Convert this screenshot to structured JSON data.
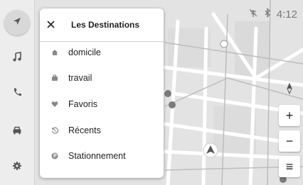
{
  "header": {
    "time": "4:12"
  },
  "sidebar": {
    "items": [
      {
        "icon": "navigation-arrow-icon"
      },
      {
        "icon": "music-note-icon"
      },
      {
        "icon": "phone-icon"
      },
      {
        "icon": "car-icon"
      },
      {
        "icon": "gear-icon"
      }
    ]
  },
  "destinations": {
    "title": "Les Destinations",
    "items": [
      {
        "label": "domicile",
        "icon": "home-icon"
      },
      {
        "label": "travail",
        "icon": "briefcase-icon"
      },
      {
        "label": "Favoris",
        "icon": "heart-icon"
      },
      {
        "label": "Récents",
        "icon": "history-icon"
      },
      {
        "label": "Stationnement",
        "icon": "parking-icon"
      }
    ]
  },
  "map_controls": {
    "zoom_in": "+",
    "zoom_out": "−",
    "menu": "≡"
  },
  "colors": {
    "panel_bg": "#ffffff",
    "sidebar_bg": "#ededed",
    "map_bg": "#e6e6e6",
    "road": "#ffffff"
  }
}
